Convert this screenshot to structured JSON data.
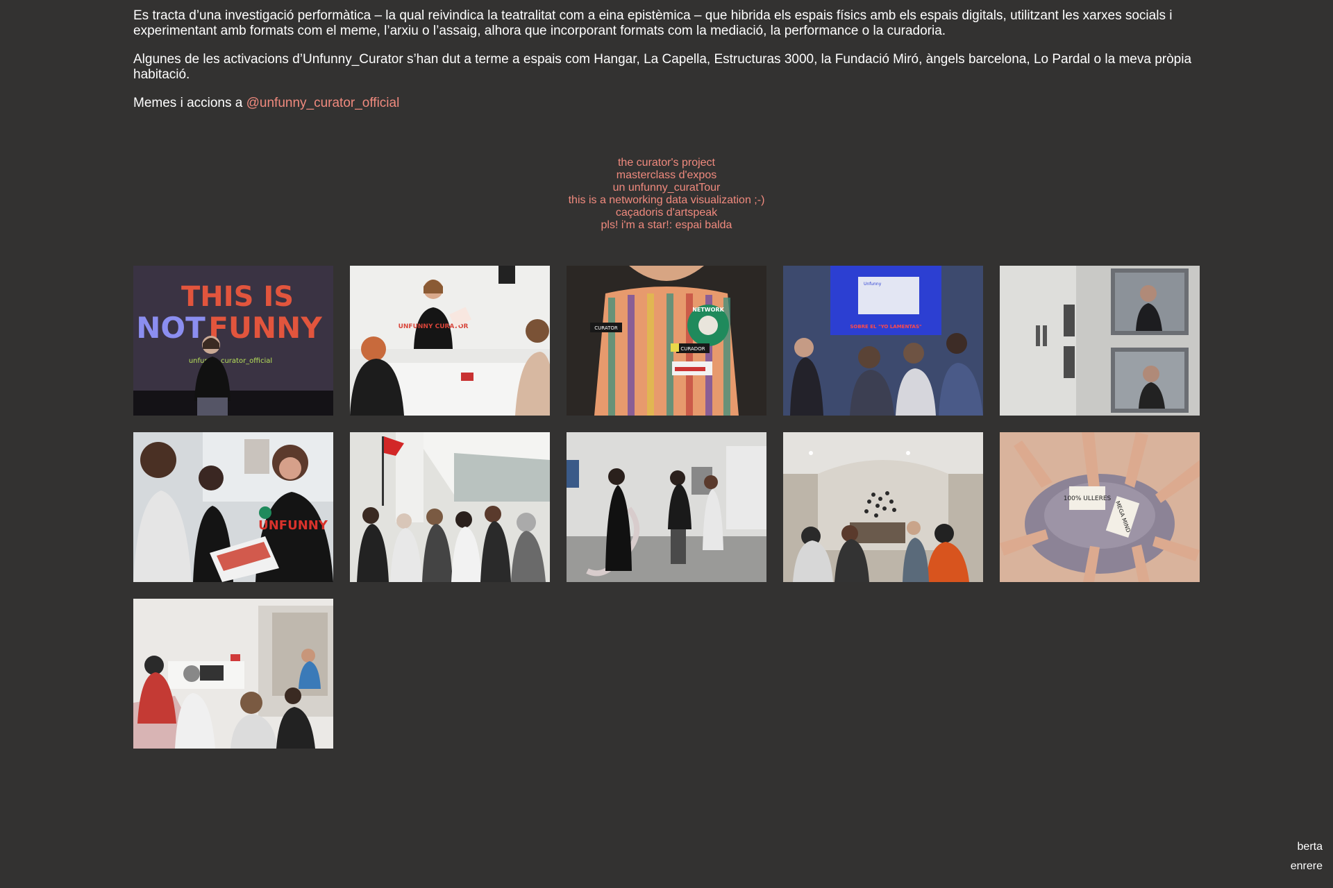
{
  "intro": {
    "paragraph1": "Es tracta d’una investigació performàtica – la qual reivindica la teatralitat com a eina epistèmica – que hibrida els espais físics amb els espais digitals, utilitzant les xarxes socials i experimentant amb formats com el meme, l’arxiu o l’assaig, alhora que incorporant formats com la mediació, la performance o la curadoria.",
    "paragraph2": "Algunes de les activacions d’Unfunny_Curator s’han dut a terme a espais com Hangar, La Capella, Estructuras 3000, la Fundació Miró, àngels barcelona, Lo Pardal o la meva pròpia habitació.",
    "memes_prefix": "Memes i accions a ",
    "memes_link": "@unfunny_curator_official"
  },
  "projects": [
    "the curator's project",
    "masterclass d'expos",
    "un unfunny_curatTour",
    "this is a networking data visualization ;-)",
    "caçadoris d'artspeak",
    "pls! i'm a star!: espai balda"
  ],
  "photos": {
    "p1": {
      "line1": "THIS IS",
      "line2": "NOT",
      "line3": "FUNNY",
      "caption": "unfunny_curator_official"
    },
    "p2": {
      "shirt": "UNFUNNY CURATOR"
    },
    "p3": {
      "badge": "NETWORK",
      "tag1": "CURATOR",
      "tag2": "CURADOR"
    },
    "p4": {
      "screen_title": "Unfunny",
      "screen_sub": "SOBRE EL \"YO LAMENTAS\""
    },
    "p6": {
      "shirt": "UNFUNNY"
    },
    "p10": {
      "sign1": "100% ULLERES",
      "sign2": "MEGA MIND"
    }
  },
  "footer": {
    "name": "berta",
    "back": "enrere"
  },
  "colors": {
    "background": "#333231",
    "text": "#ffffff",
    "link": "#f08a7e"
  }
}
